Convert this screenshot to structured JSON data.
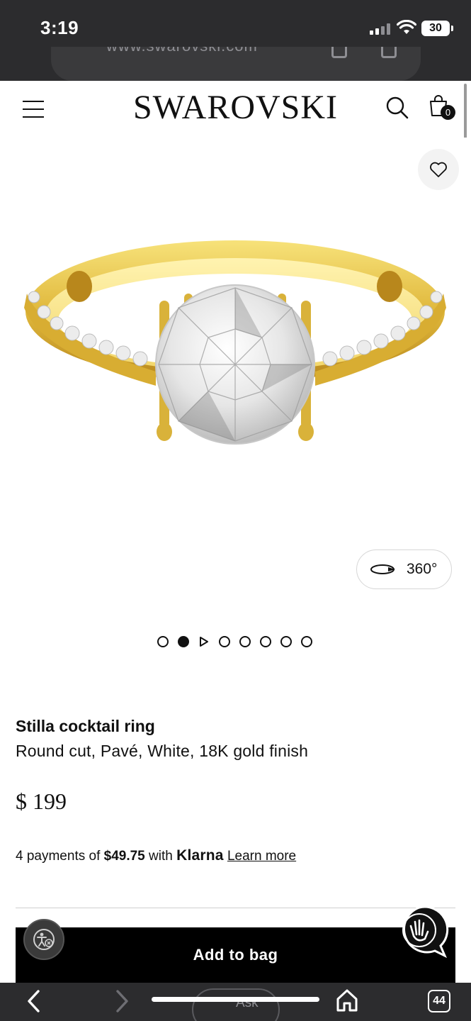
{
  "status_bar": {
    "time": "3:19",
    "battery": "30"
  },
  "browser": {
    "url": "www.swarovski.com"
  },
  "header": {
    "logo": "SWAROVSKI",
    "bag_count": "0"
  },
  "product": {
    "rotate_label": "360°",
    "gallery": {
      "total_items": 8,
      "active_index": 1,
      "video_index": 2
    },
    "title": "Stilla cocktail ring",
    "description": "Round cut, Pavé, White, 18K gold finish",
    "price": "$ 199",
    "klarna": {
      "prefix": "4 payments of ",
      "amount": "$49.75",
      "with": " with ",
      "brand": "Klarna",
      "link": "Learn more"
    },
    "add_to_bag_label": "Add to bag"
  },
  "safari_toolbar": {
    "ask_label": "Ask",
    "tab_count": "44"
  },
  "colors": {
    "chrome_dark": "#2c2c2e",
    "accent_black": "#000000",
    "gold": "#d9b23a"
  }
}
